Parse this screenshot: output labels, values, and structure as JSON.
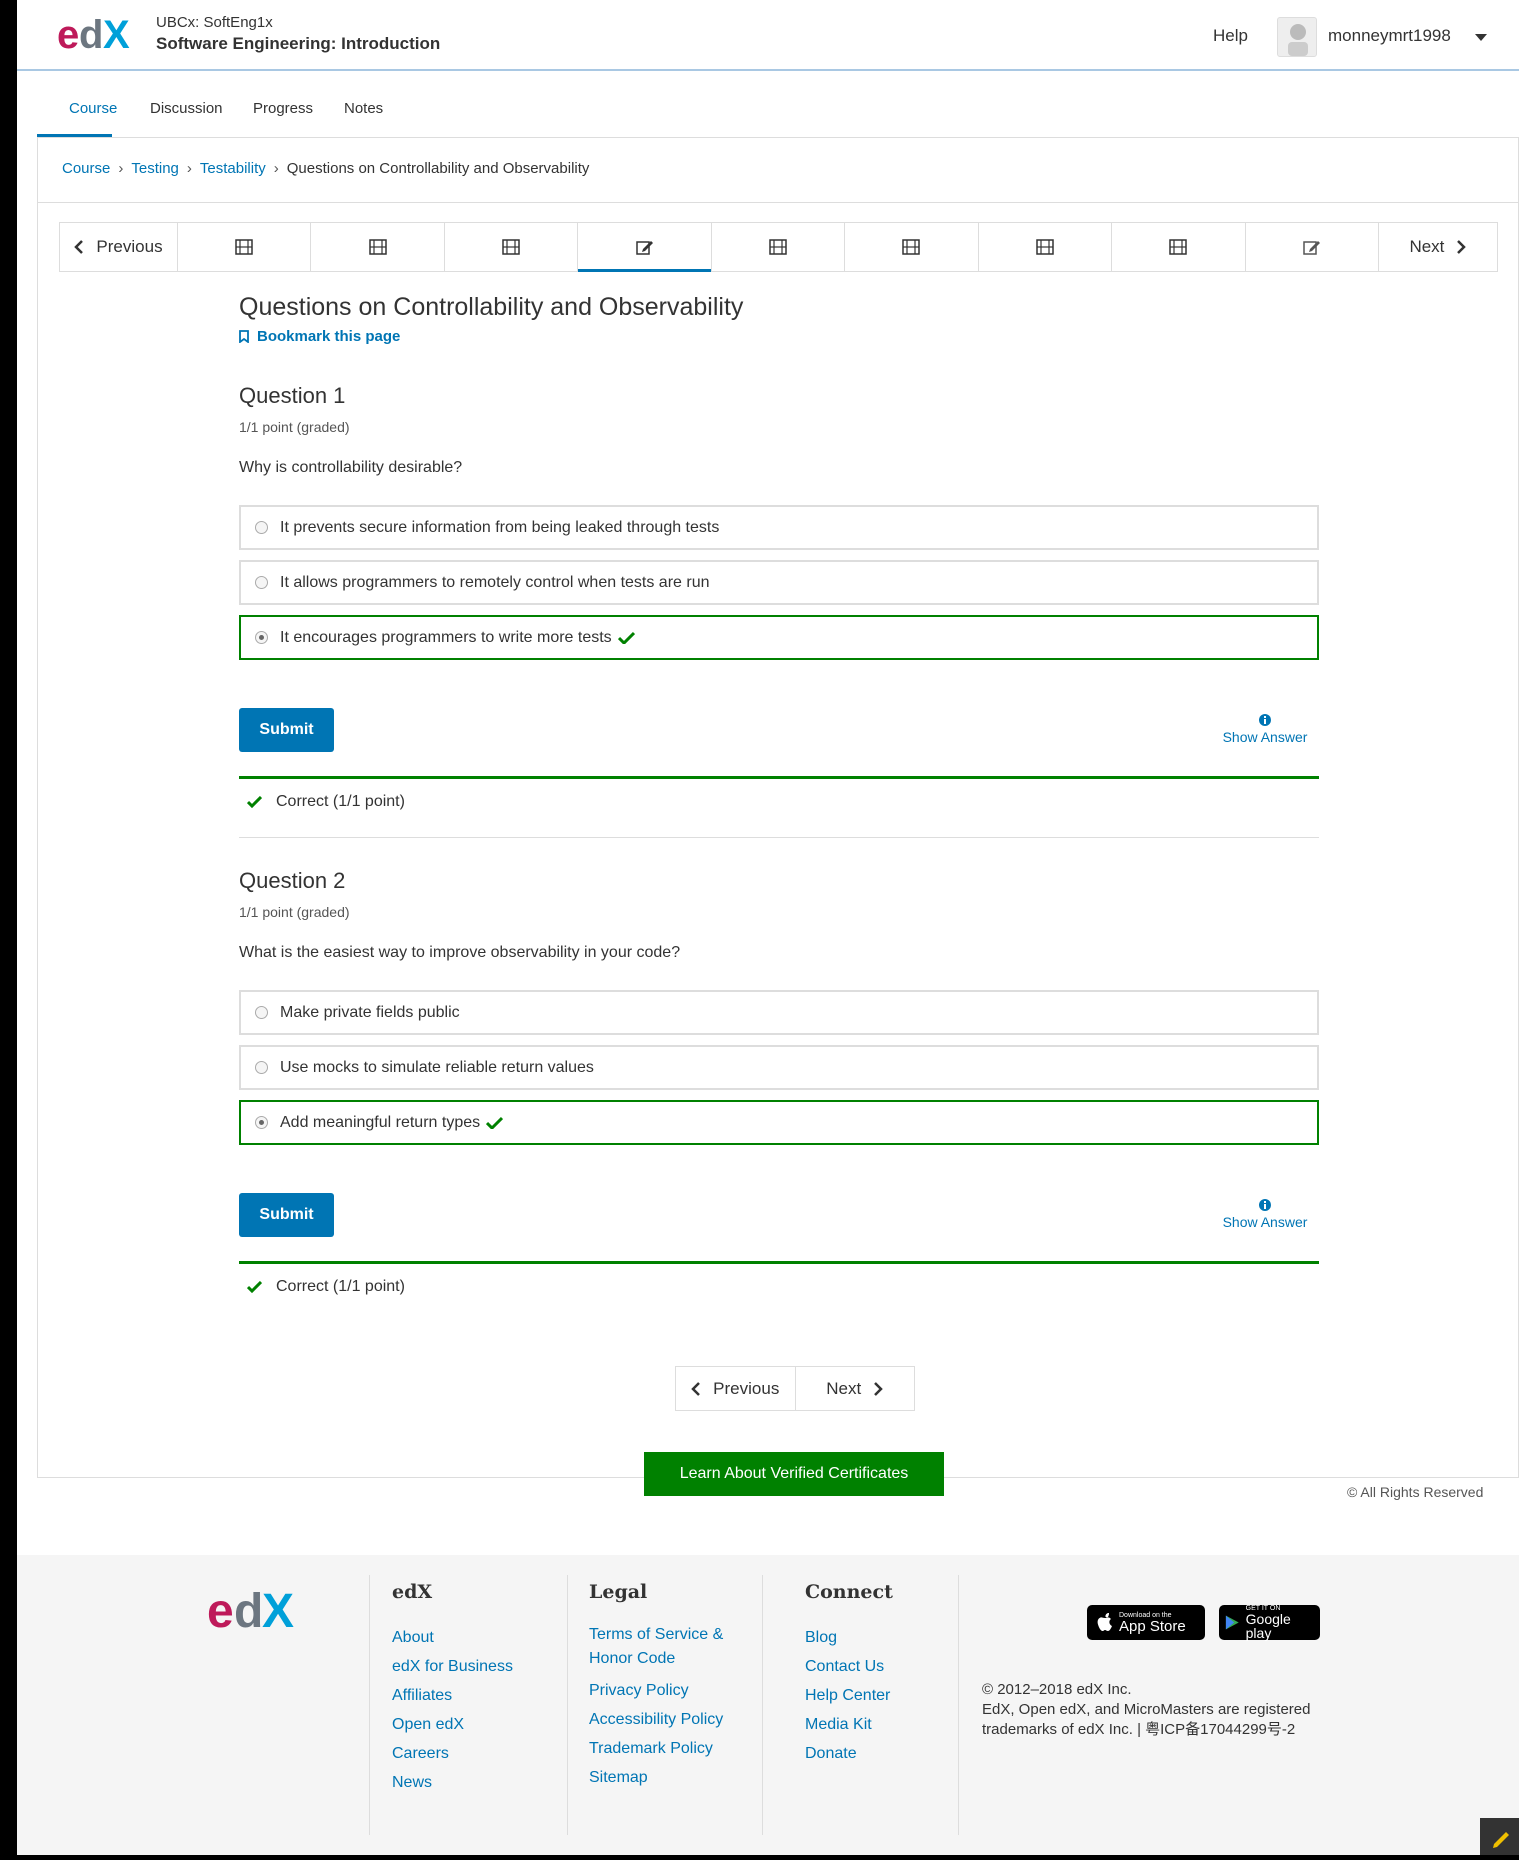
{
  "header": {
    "course_org": "UBCx: SoftEng1x",
    "course_title": "Software Engineering: Introduction",
    "help": "Help",
    "username": "monneymrt1998"
  },
  "tabs": [
    "Course",
    "Discussion",
    "Progress",
    "Notes"
  ],
  "breadcrumb": {
    "items": [
      "Course",
      "Testing",
      "Testability"
    ],
    "current": "Questions on Controllability and Observability"
  },
  "seqnav": {
    "previous": "Previous",
    "next": "Next",
    "items": [
      "video-icon",
      "video-icon",
      "video-icon",
      "edit-icon",
      "video-icon",
      "video-icon",
      "video-icon",
      "video-icon",
      "edit-icon"
    ],
    "active_index": 3
  },
  "unit": {
    "title": "Questions on Controllability and Observability",
    "bookmark": "Bookmark this page"
  },
  "problems": [
    {
      "title": "Question 1",
      "points": "1/1 point (graded)",
      "question": "Why is controllability desirable?",
      "choices": [
        "It prevents secure information from being leaked through tests",
        "It allows programmers to remotely control when tests are run",
        "It encourages programmers to write more tests"
      ],
      "selected": 2,
      "submit": "Submit",
      "show_answer": "Show Answer",
      "status": "Correct (1/1 point)"
    },
    {
      "title": "Question 2",
      "points": "1/1 point (graded)",
      "question": "What is the easiest way to improve observability in your code?",
      "choices": [
        "Make private fields public",
        "Use mocks to simulate reliable return values",
        "Add meaningful return types"
      ],
      "selected": 2,
      "submit": "Submit",
      "show_answer": "Show Answer",
      "status": "Correct (1/1 point)"
    }
  ],
  "bottom_nav": {
    "previous": "Previous",
    "next": "Next"
  },
  "verified_button": "Learn About Verified Certificates",
  "rights": "© All Rights Reserved",
  "footer": {
    "edx": {
      "heading": "edX",
      "links": [
        "About",
        "edX for Business",
        "Affiliates",
        "Open edX",
        "Careers",
        "News"
      ]
    },
    "legal": {
      "heading": "Legal",
      "links": [
        "Terms of Service & Honor Code",
        "Privacy Policy",
        "Accessibility Policy",
        "Trademark Policy",
        "Sitemap"
      ]
    },
    "connect": {
      "heading": "Connect",
      "links": [
        "Blog",
        "Contact Us",
        "Help Center",
        "Media Kit",
        "Donate"
      ]
    },
    "app_store": {
      "small": "Download on the",
      "big": "App Store"
    },
    "google_play": {
      "small": "GET IT ON",
      "big": "Google play"
    },
    "copyright": "© 2012–2018 edX Inc.",
    "trademark": "EdX, Open edX, and MicroMasters are registered trademarks of edX Inc. | 粤ICP备17044299号-2"
  },
  "colors": {
    "accent": "#0075b4",
    "success": "#008100"
  }
}
